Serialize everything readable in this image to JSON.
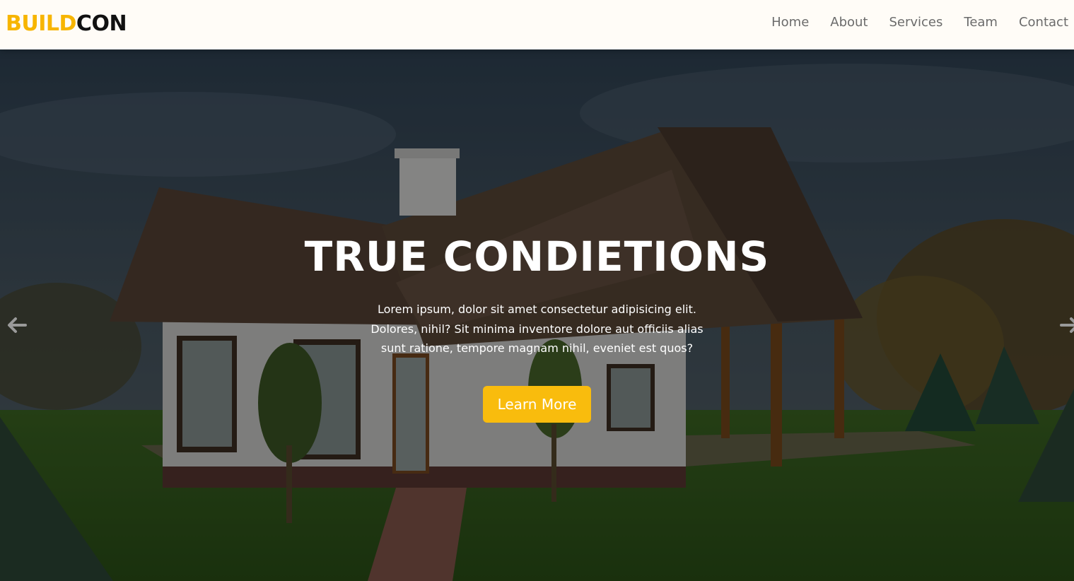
{
  "brand": {
    "part1": "BUILD",
    "part2": "CON",
    "accent_color": "#f7b500"
  },
  "nav": {
    "items": [
      "Home",
      "About",
      "Services",
      "Team",
      "Contact"
    ]
  },
  "hero": {
    "title": "TRUE CONDIETIONS",
    "text": "Lorem ipsum, dolor sit amet consectetur adipisicing elit. Dolores, nihil? Sit minima inventore dolore aut officiis alias sunt ratione, tempore magnam nihil, eveniet est quos?",
    "button_label": "Learn More",
    "button_color": "#f9bc0d",
    "prev_icon": "arrow-left-icon",
    "next_icon": "arrow-right-icon"
  }
}
